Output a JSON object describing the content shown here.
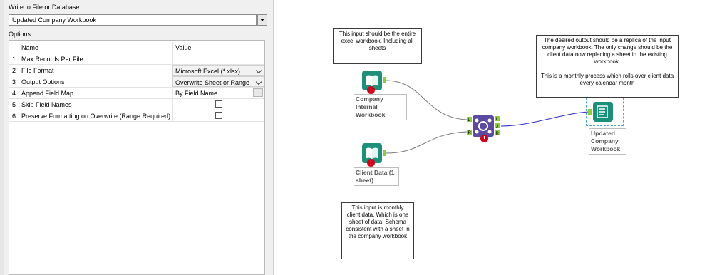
{
  "config": {
    "write_label": "Write to File or Database",
    "destination_value": "Updated Company Workbook",
    "options_label": "Options",
    "columns": {
      "name": "Name",
      "value": "Value"
    },
    "rows": [
      {
        "num": "1",
        "name": "Max Records Per File",
        "value": ""
      },
      {
        "num": "2",
        "name": "File Format",
        "value": "Microsoft Excel (*.xlsx)"
      },
      {
        "num": "3",
        "name": "Output Options",
        "value": "Overwrite Sheet or Range"
      },
      {
        "num": "4",
        "name": "Append Field Map",
        "value": "By Field Name",
        "button": "..."
      },
      {
        "num": "5",
        "name": "Skip Field Names",
        "checked": false
      },
      {
        "num": "6",
        "name": "Preserve Formatting on Overwrite (Range Required)",
        "checked": false
      }
    ]
  },
  "canvas": {
    "comments": {
      "input_note": "This input should be the entire excel workbook. Including all sheets",
      "output_note": "The desired output should be a replica of the input company workbook. The only change should be the client data now replacing a sheet in the existing workbook.\n\nThis is a monthly process which rolls over client data every calendar month",
      "client_note": "This input is monthly client data. Which is one sheet of data. Schema consistent with a sheet in the company workbook"
    },
    "tools": {
      "company_input": "Company Internal Workbook",
      "client_input": "Client Data (1 sheet)",
      "output": "Updated Company Workbook"
    },
    "anchors": {
      "join_left": "L",
      "join_right": "R",
      "join_out_left": "L",
      "join_out_join": "J",
      "join_out_right": "R"
    },
    "error_mark": "!",
    "colors": {
      "input_tool": "#1f8f7a",
      "output_tool": "#1a8f7a",
      "join_tool": "#5c4a9e",
      "anchor": "#8ccf3e",
      "wire": "#7a7a7a",
      "output_wire": "#2a2ac8",
      "error": "#d0021b"
    }
  }
}
